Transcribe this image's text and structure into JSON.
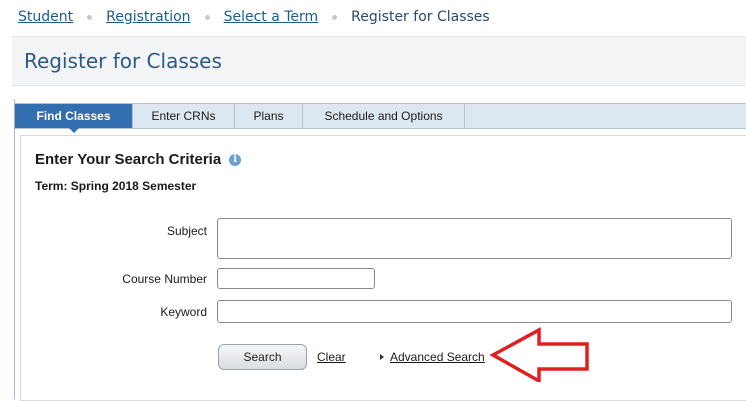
{
  "breadcrumb": {
    "items": [
      {
        "label": "Student"
      },
      {
        "label": "Registration"
      },
      {
        "label": "Select a Term"
      },
      {
        "label": "Register for Classes"
      }
    ]
  },
  "header": {
    "title": "Register for Classes"
  },
  "tabs": [
    {
      "label": "Find Classes",
      "active": true
    },
    {
      "label": "Enter CRNs",
      "active": false
    },
    {
      "label": "Plans",
      "active": false
    },
    {
      "label": "Schedule and Options",
      "active": false
    }
  ],
  "search": {
    "title": "Enter Your Search Criteria",
    "info_icon": "info-icon",
    "term": "Term: Spring 2018 Semester",
    "fields": {
      "subject": {
        "label": "Subject",
        "value": ""
      },
      "course_number": {
        "label": "Course Number",
        "value": ""
      },
      "keyword": {
        "label": "Keyword",
        "value": ""
      }
    },
    "search_button": "Search",
    "clear_link": "Clear",
    "advanced_search": "Advanced Search"
  },
  "colors": {
    "active_tab": "#336fb0",
    "tab_bar": "#dde7f1",
    "title_blue": "#2d5a86",
    "annotation_arrow": "#e02020"
  }
}
